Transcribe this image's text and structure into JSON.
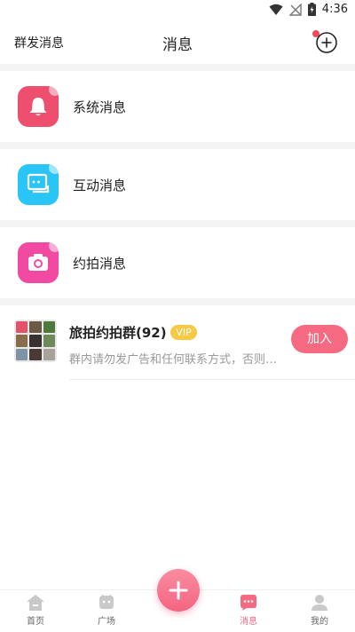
{
  "status_bar": {
    "time": "4:36"
  },
  "header": {
    "left_label": "群发消息",
    "title": "消息"
  },
  "categories": [
    {
      "label": "系统消息",
      "icon": "bell-icon",
      "color": "#ee4f6e"
    },
    {
      "label": "互动消息",
      "icon": "chat-icon",
      "color": "#29c5f6"
    },
    {
      "label": "约拍消息",
      "icon": "camera-icon",
      "color": "#f24aa3"
    }
  ],
  "group": {
    "title": "旅拍约拍群(92)",
    "badge": "VIP",
    "description": "群内请勿发广告和任何联系方式，否则将被踢出群聊",
    "join_label": "加入"
  },
  "bottom_nav": {
    "items": [
      {
        "label": "首页",
        "icon": "home-icon"
      },
      {
        "label": "广场",
        "icon": "square-icon"
      },
      {
        "label": "消息",
        "icon": "message-icon",
        "active": true
      },
      {
        "label": "我的",
        "icon": "profile-icon"
      }
    ],
    "fab_icon": "plus-icon"
  },
  "colors": {
    "accent": "#f56a81",
    "vip": "#f7c945",
    "notification_dot": "#ef4a5a"
  }
}
